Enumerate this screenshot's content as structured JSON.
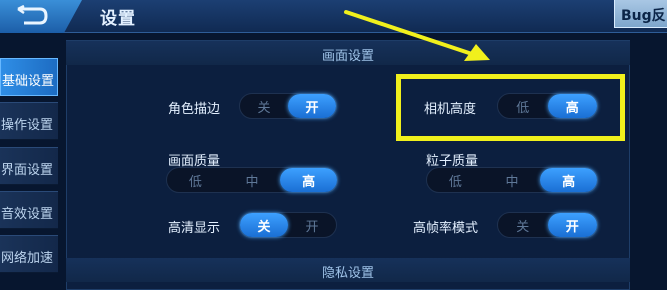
{
  "header": {
    "title": "设置",
    "bug_button": "Bug反"
  },
  "sidebar": {
    "items": [
      {
        "label": "基础设置",
        "active": true
      },
      {
        "label": "操作设置",
        "active": false
      },
      {
        "label": "界面设置",
        "active": false
      },
      {
        "label": "音效设置",
        "active": false
      },
      {
        "label": "网络加速",
        "active": false
      }
    ]
  },
  "sections": {
    "display": "画面设置",
    "privacy": "隐私设置"
  },
  "settings": {
    "character_outline": {
      "label": "角色描边",
      "options": [
        "关",
        "开"
      ],
      "selected": "开"
    },
    "camera_height": {
      "label": "相机高度",
      "options": [
        "低",
        "高"
      ],
      "selected": "高"
    },
    "picture_quality": {
      "label": "画面质量",
      "options": [
        "低",
        "中",
        "高"
      ],
      "selected": "高"
    },
    "particle_quality": {
      "label": "粒子质量",
      "options": [
        "低",
        "中",
        "高"
      ],
      "selected": "高"
    },
    "hd_display": {
      "label": "高清显示",
      "options": [
        "关",
        "开"
      ],
      "selected": "关"
    },
    "high_fps_mode": {
      "label": "高帧率模式",
      "options": [
        "关",
        "开"
      ],
      "selected": "开"
    }
  },
  "colors": {
    "accent": "#2f8ee6",
    "annotation": "#f1f01c",
    "panel": "#0c1f3f"
  },
  "icons": {
    "back": "back-arrow-icon",
    "annotation_arrow": "pointer-arrow-icon"
  }
}
